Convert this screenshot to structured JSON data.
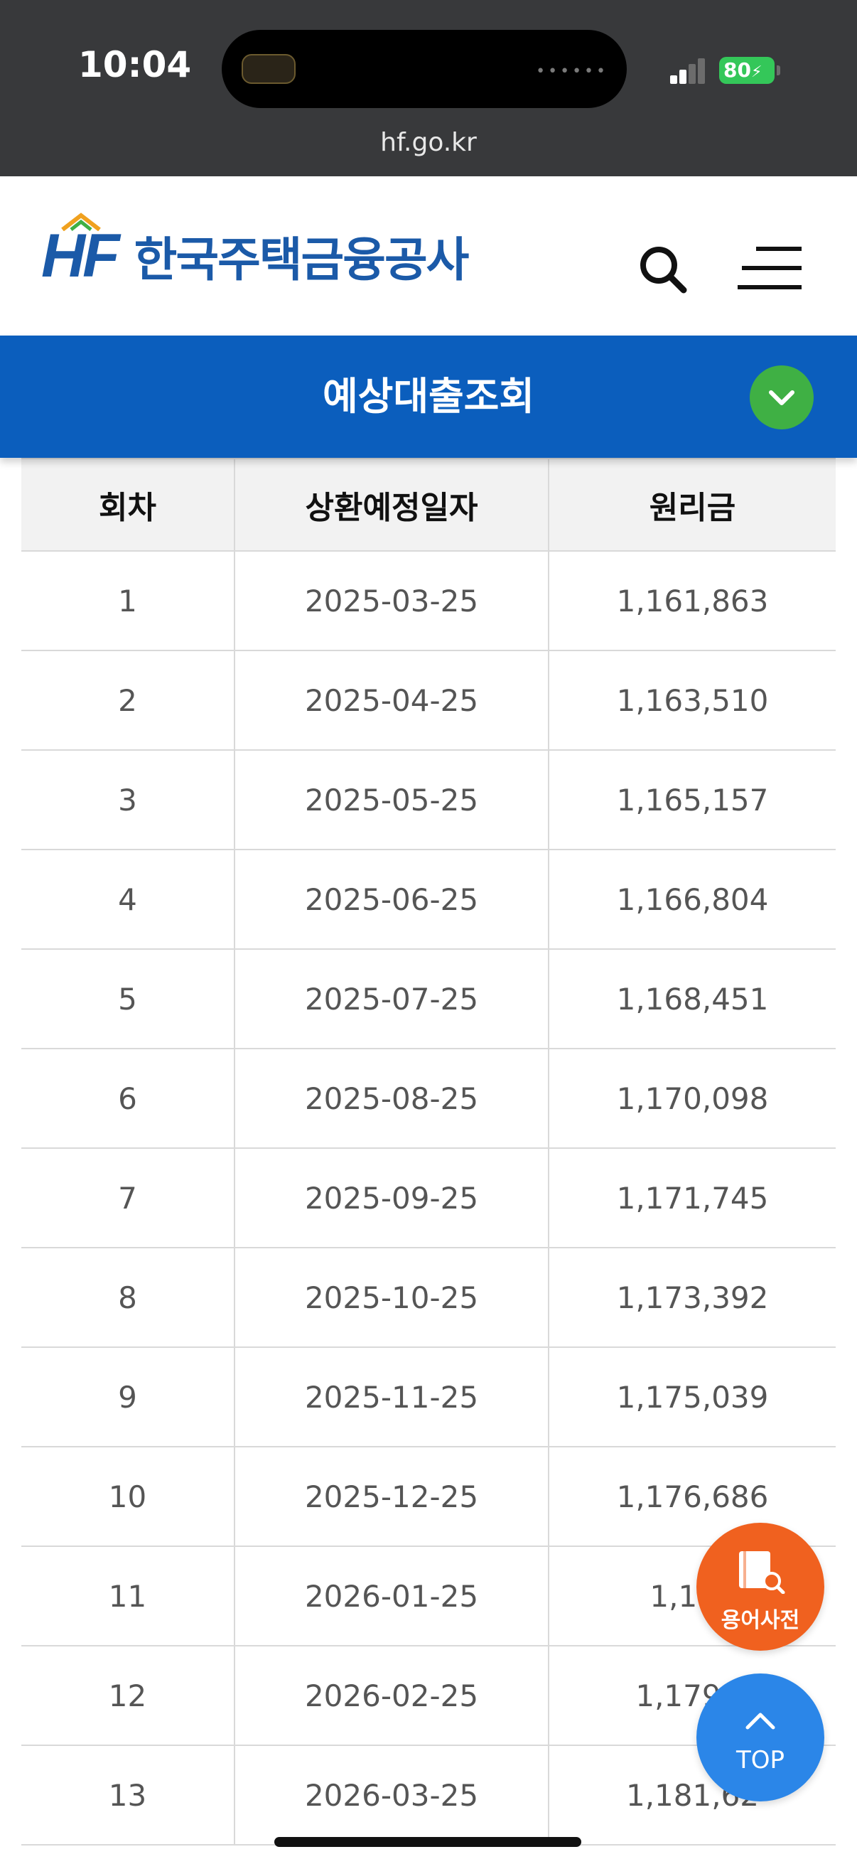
{
  "status_bar": {
    "time": "10:04",
    "battery": "80",
    "url": "hf.go.kr"
  },
  "header": {
    "logo_mark": "HF",
    "logo_name": "한국주택금융공사",
    "search_icon": "search-icon",
    "menu_icon": "hamburger-menu-icon"
  },
  "section_bar": {
    "title": "예상대출조회",
    "toggle_icon": "chevron-down-icon"
  },
  "table": {
    "headers": [
      "회차",
      "상환예정일자",
      "원리금"
    ],
    "rows": [
      [
        "1",
        "2025-03-25",
        "1,161,863"
      ],
      [
        "2",
        "2025-04-25",
        "1,163,510"
      ],
      [
        "3",
        "2025-05-25",
        "1,165,157"
      ],
      [
        "4",
        "2025-06-25",
        "1,166,804"
      ],
      [
        "5",
        "2025-07-25",
        "1,168,451"
      ],
      [
        "6",
        "2025-08-25",
        "1,170,098"
      ],
      [
        "7",
        "2025-09-25",
        "1,171,745"
      ],
      [
        "8",
        "2025-10-25",
        "1,173,392"
      ],
      [
        "9",
        "2025-11-25",
        "1,175,039"
      ],
      [
        "10",
        "2025-12-25",
        "1,176,686"
      ],
      [
        "11",
        "2026-01-25",
        "1,178"
      ],
      [
        "12",
        "2026-02-25",
        "1,179,9"
      ],
      [
        "13",
        "2026-03-25",
        "1,181,62"
      ]
    ]
  },
  "floating": {
    "dictionary_label": "용어사전",
    "top_label": "TOP"
  },
  "colors": {
    "brand_blue": "#1b5aa8",
    "bar_blue": "#0b5ebd",
    "toggle_green": "#3fb044",
    "dict_orange": "#f0611f",
    "top_blue": "#2b86e8"
  }
}
